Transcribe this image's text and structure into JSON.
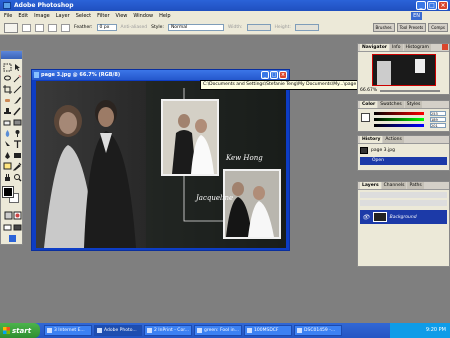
{
  "app": {
    "title": "Adobe Photoshop",
    "lang": "EN"
  },
  "menu": [
    "File",
    "Edit",
    "Image",
    "Layer",
    "Select",
    "Filter",
    "View",
    "Window",
    "Help"
  ],
  "options": {
    "feather_label": "Feather:",
    "feather_value": "0 px",
    "antialias_label": "Anti-aliased",
    "style_label": "Style:",
    "style_value": "Normal",
    "width_label": "Width:",
    "height_label": "Height:"
  },
  "well_tabs": [
    "Brushes",
    "Tool Presets",
    "Comps"
  ],
  "document": {
    "title": "page 3.jpg @ 66.7% (RGB/8)",
    "caption_1": "Kew Hong",
    "caption_2": "Jacqueline"
  },
  "tooltip": "C:\\Documents and Settings\\Stefanie Teng\\My Documents\\My...\\page 3.jpg @ 66.7% (RGB/8)",
  "navigator": {
    "tabs": [
      "Navigator",
      "Info",
      "Histogram"
    ],
    "zoom": "66.67%"
  },
  "color": {
    "tabs": [
      "Color",
      "Swatches",
      "Styles"
    ],
    "r": "253",
    "g": "189",
    "b": "201"
  },
  "history": {
    "tabs": [
      "History",
      "Actions"
    ],
    "snapshot": "page 3.jpg",
    "step": "Open"
  },
  "layers": {
    "tabs": [
      "Layers",
      "Channels",
      "Paths"
    ],
    "layer_name": "Background"
  },
  "taskbar": {
    "start": "start",
    "tasks": [
      "3 Internet E...",
      "Adobe Photo...",
      "2 InPrint - Cor...",
      "green: Fool in...",
      "100MSDCF",
      "DSC01459 -..."
    ],
    "time": "9:20 PM"
  },
  "colors": {
    "xp_blue": "#2557cc",
    "panel": "#ece9d8",
    "workspace": "#7f7f7f",
    "highlight": "#1c3aa8"
  }
}
